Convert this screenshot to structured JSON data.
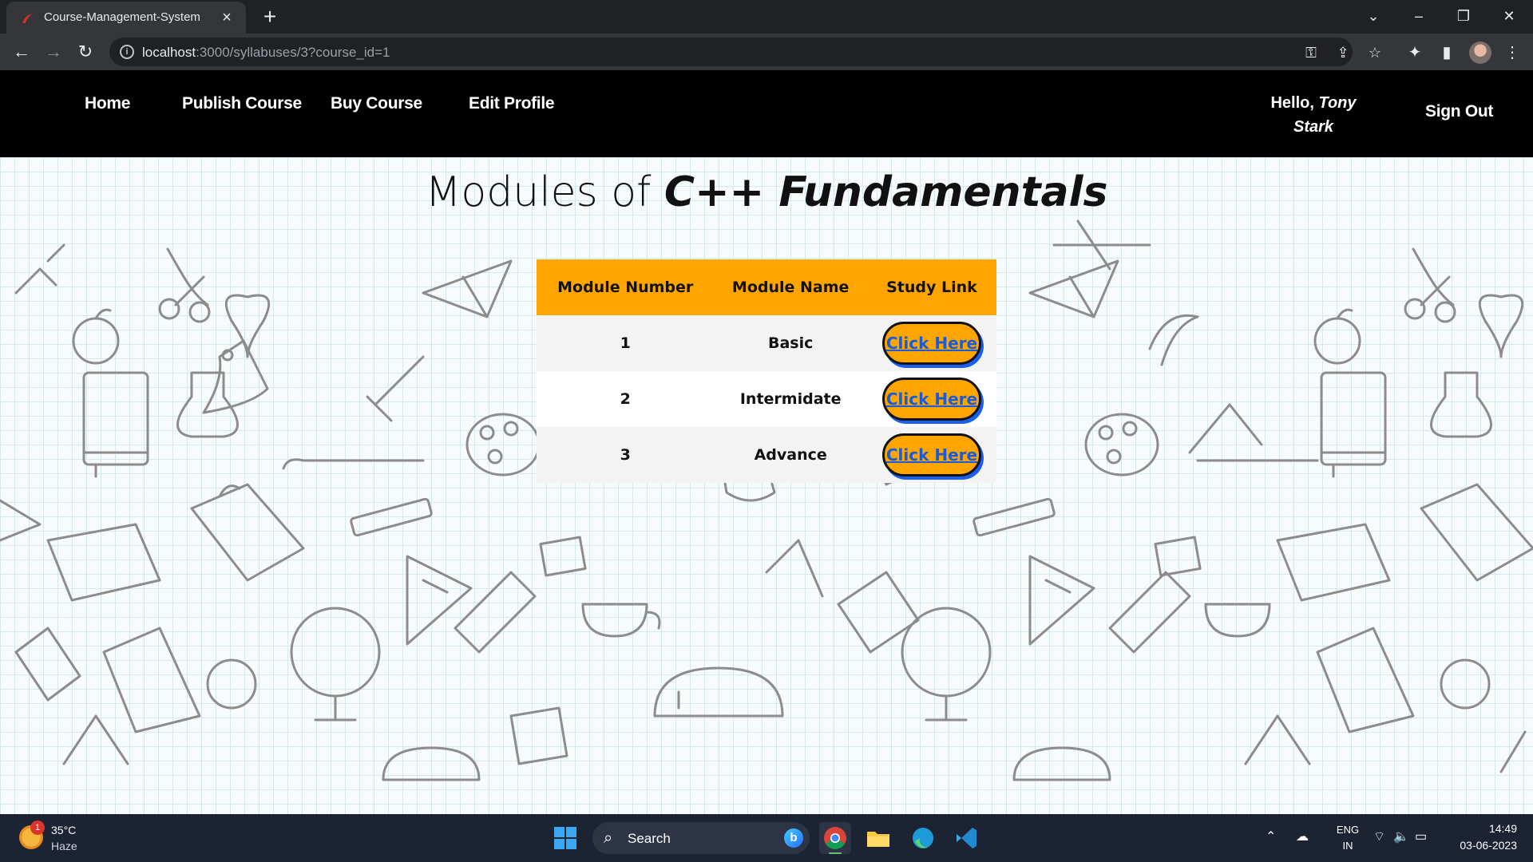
{
  "browser": {
    "tab_title": "Course-Management-System",
    "url_host": "localhost",
    "url_rest": ":3000/syllabuses/3?course_id=1"
  },
  "nav": {
    "home": "Home",
    "publish": "Publish Course",
    "buy": "Buy Course",
    "edit_profile": "Edit Profile",
    "greeting_prefix": "Hello,",
    "user_first": "Tony",
    "user_last": "Stark",
    "sign_out": "Sign Out"
  },
  "page": {
    "title_prefix": "Modules of",
    "course_name": "C++ Fundamentals"
  },
  "table": {
    "headers": [
      "Module Number",
      "Module Name",
      "Study Link"
    ],
    "rows": [
      {
        "number": "1",
        "name": "Basic",
        "link": "Click Here"
      },
      {
        "number": "2",
        "name": "Intermidate",
        "link": "Click Here"
      },
      {
        "number": "3",
        "name": "Advance",
        "link": "Click Here"
      }
    ]
  },
  "colors": {
    "header_bg": "#000000",
    "accent": "#ffa500",
    "link": "#1a5bd8"
  },
  "taskbar": {
    "weather_badge": "1",
    "temperature": "35°C",
    "condition": "Haze",
    "search_label": "Search",
    "lang_line1": "ENG",
    "lang_line2": "IN",
    "time": "14:49",
    "date": "03-06-2023"
  }
}
